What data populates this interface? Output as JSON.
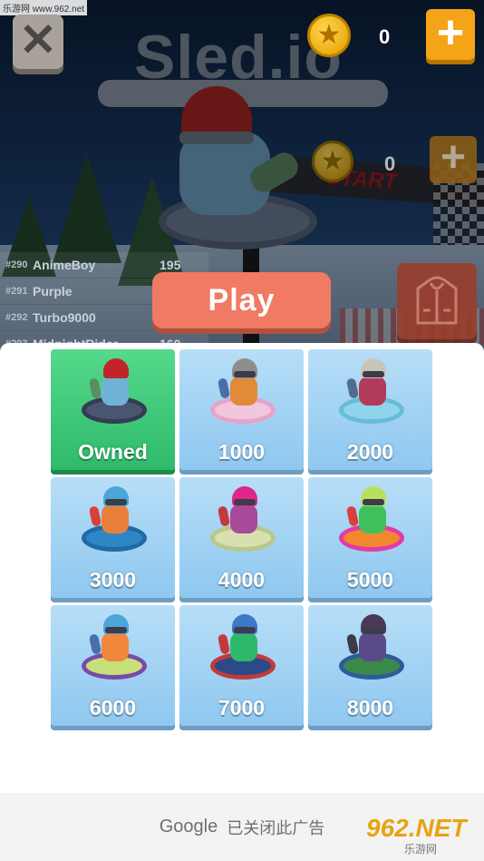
{
  "watermark_top": "乐游网 www.962.net",
  "hud": {
    "close_glyph": "✕",
    "coins": "0",
    "coins_background": "0",
    "plus_glyph": "+",
    "star_glyph": "★"
  },
  "logo_text": "Sled.io",
  "start_text": "START",
  "leaderboard": [
    {
      "rank": "#290",
      "name": "AnimeBoy",
      "score": "195"
    },
    {
      "rank": "#291",
      "name": "Purple",
      "score": ""
    },
    {
      "rank": "#292",
      "name": "Turbo9000",
      "score": ""
    },
    {
      "rank": "#293",
      "name": "MidnightRider",
      "score": "160"
    }
  ],
  "play_label": "Play",
  "outfit_icon": "hoodie-icon",
  "shop": [
    {
      "label": "Owned",
      "owned": true,
      "hat": "#c0252a",
      "body": "#6fb3d8",
      "tube": "#4a5570",
      "tube_border": "#333c52",
      "leg": "#5b8b63",
      "goggle": false
    },
    {
      "label": "1000",
      "owned": false,
      "hat": "#8d8d8d",
      "body": "#e08a3a",
      "tube": "#f3c6df",
      "tube_border": "#e6a3c8",
      "leg": "#4a6fa8",
      "goggle": true
    },
    {
      "label": "2000",
      "owned": false,
      "hat": "#c8c6b8",
      "body": "#b23a5a",
      "tube": "#8fd4ea",
      "tube_border": "#66bcd9",
      "leg": "#4f6d8f",
      "goggle": true
    },
    {
      "label": "3000",
      "owned": false,
      "hat": "#4aa6d8",
      "body": "#e8803b",
      "tube": "#2f86c4",
      "tube_border": "#1f6aa6",
      "leg": "#d8403a",
      "goggle": true
    },
    {
      "label": "4000",
      "owned": false,
      "hat": "#e0268a",
      "body": "#a84a9a",
      "tube": "#d8e0b0",
      "tube_border": "#bac78a",
      "leg": "#c43a3a",
      "goggle": true
    },
    {
      "label": "5000",
      "owned": false,
      "hat": "#b8e05a",
      "body": "#3fc05a",
      "tube": "#f2882e",
      "tube_border": "#e23aa8",
      "leg": "#d8403a",
      "goggle": true
    },
    {
      "label": "6000",
      "owned": false,
      "hat": "#4aa6d8",
      "body": "#f0873b",
      "tube": "#c8e07a",
      "tube_border": "#7a4aa8",
      "leg": "#4a6fa8",
      "goggle": true
    },
    {
      "label": "7000",
      "owned": false,
      "hat": "#3a78c8",
      "body": "#2fb86a",
      "tube": "#2a4a8a",
      "tube_border": "#c23a3a",
      "leg": "#c43a3a",
      "goggle": true
    },
    {
      "label": "8000",
      "owned": false,
      "hat": "#4a3a5a",
      "body": "#5a4a8a",
      "tube": "#3a8a4a",
      "tube_border": "#2f5a9a",
      "leg": "#3a3a4a",
      "goggle": true
    }
  ],
  "ad": {
    "google": "Google",
    "closed_text": "已关闭此广告"
  },
  "watermark_br": {
    "big": "962.NET",
    "small": "乐游网"
  }
}
